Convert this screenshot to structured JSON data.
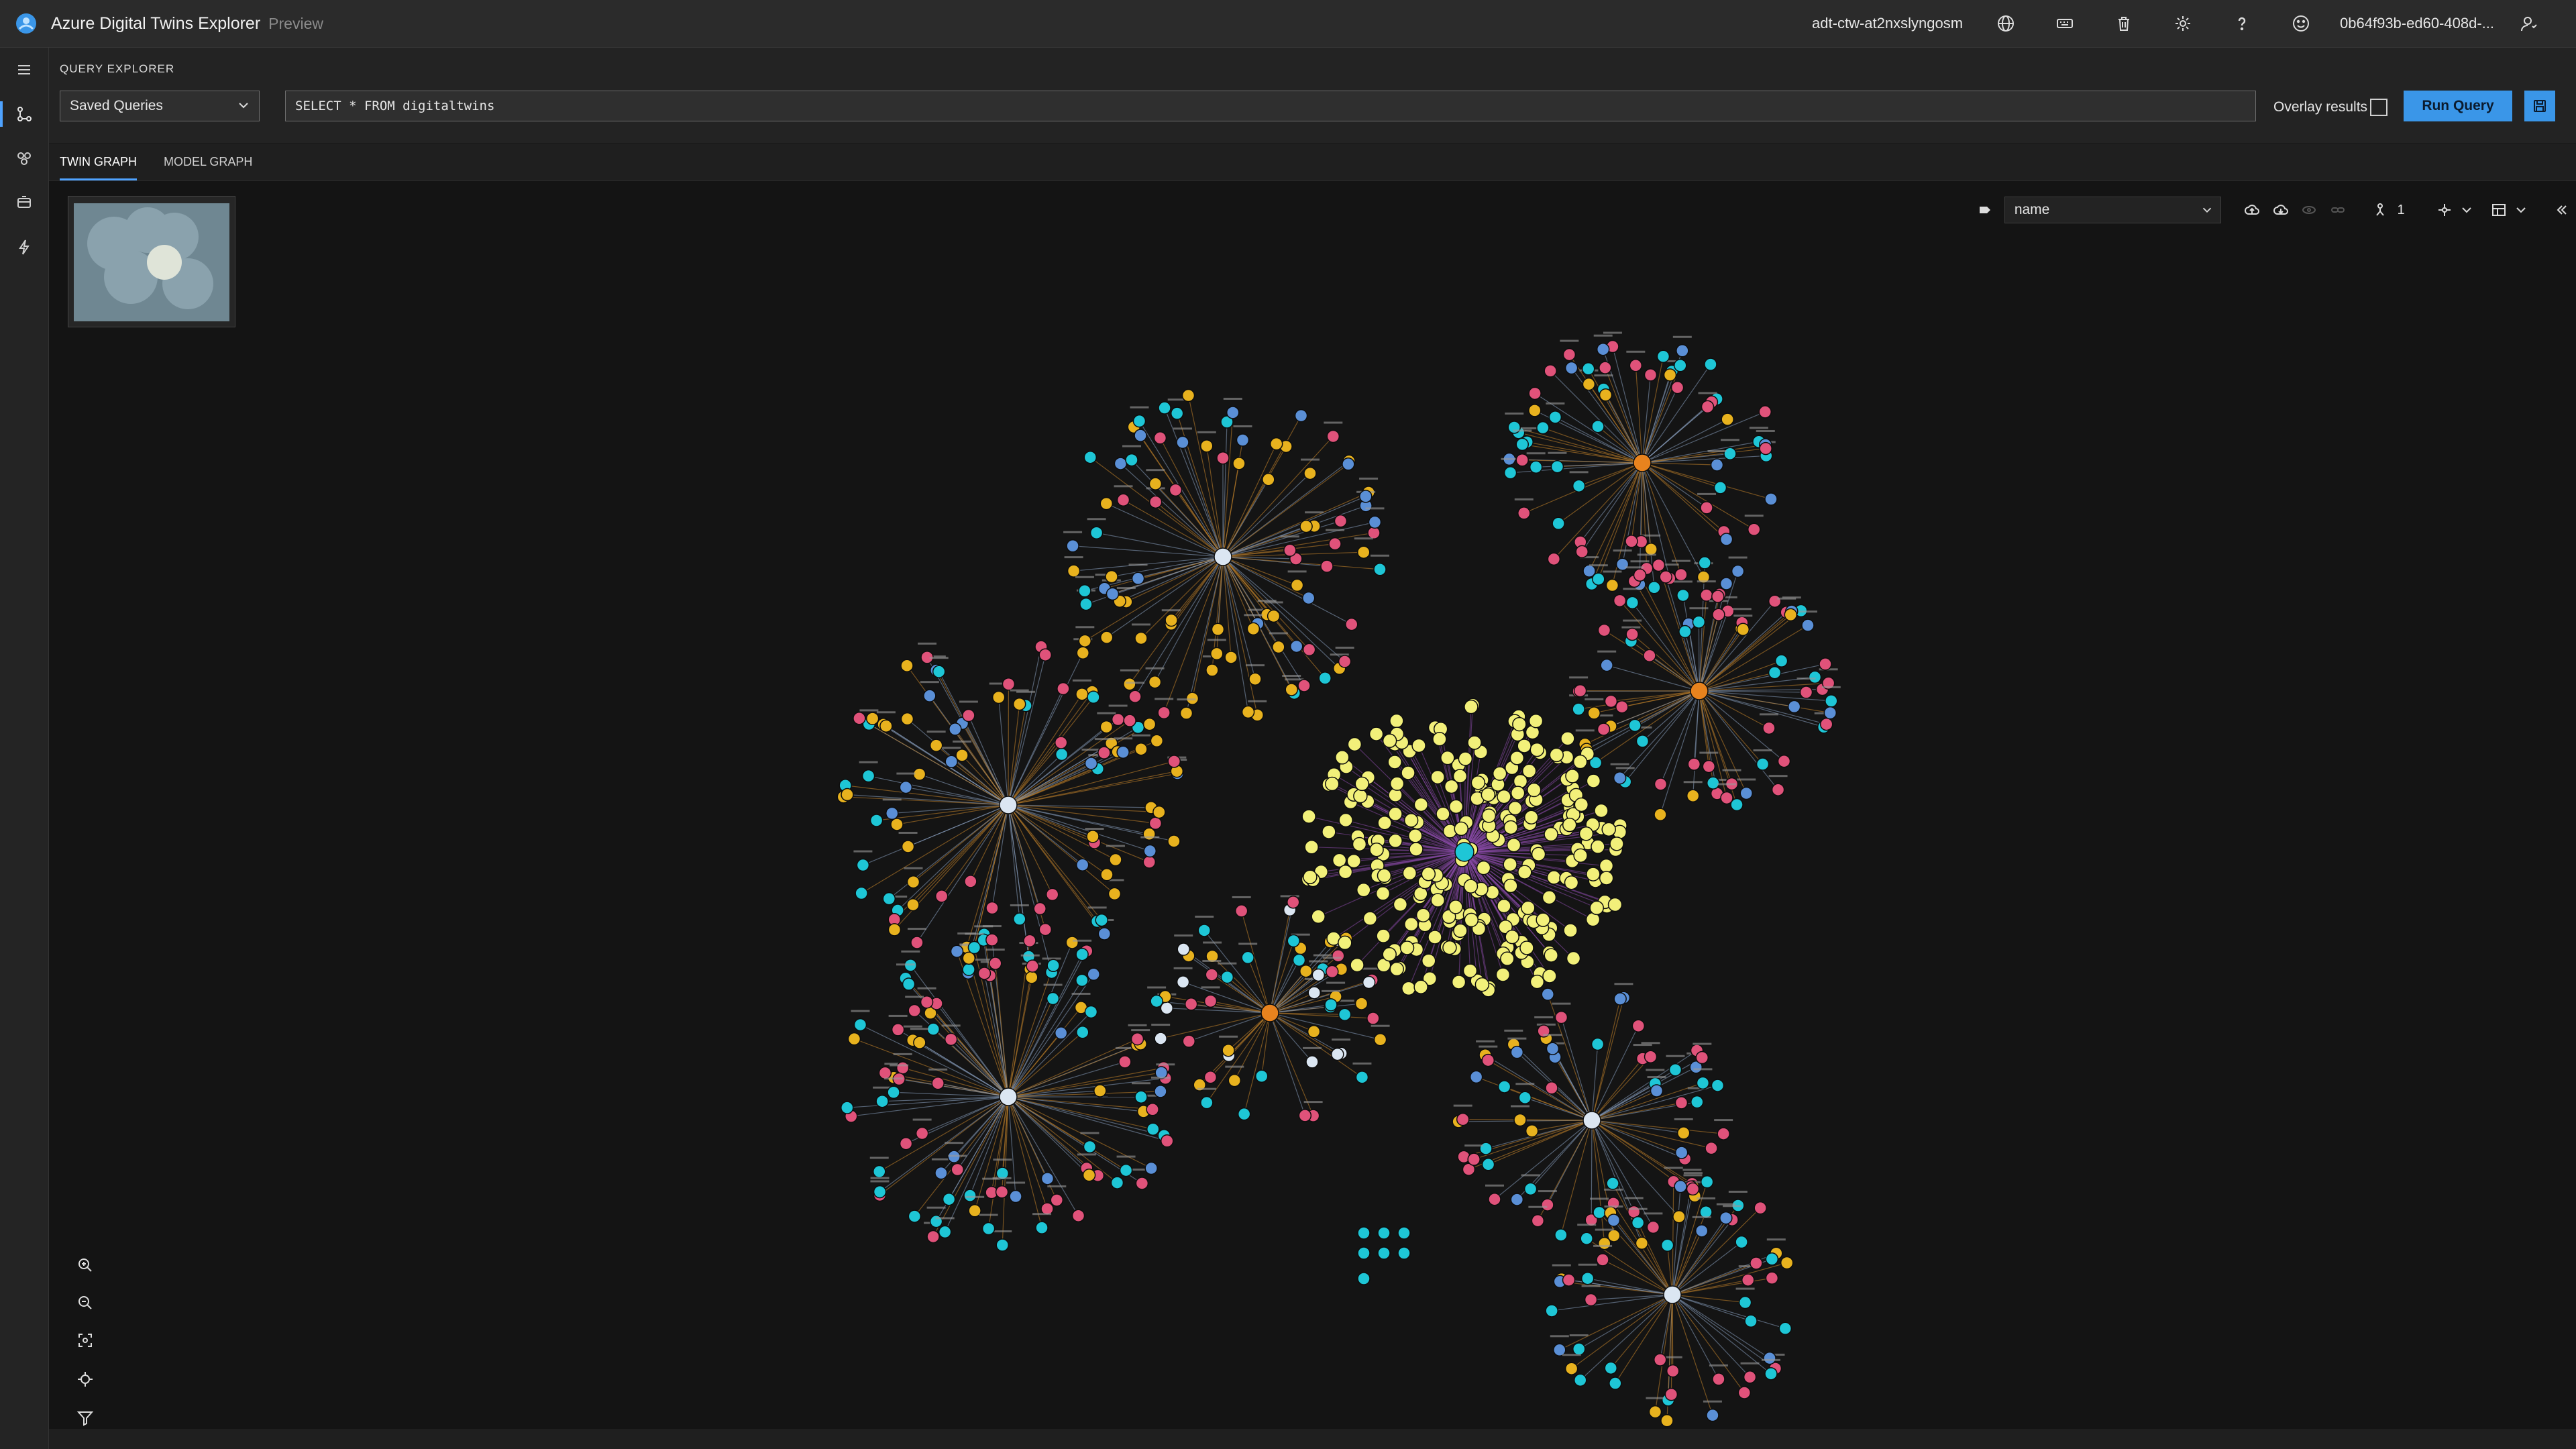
{
  "app": {
    "title": "Azure Digital Twins Explorer",
    "badge": "Preview",
    "environment": "adt-ctw-at2nxslyngosm",
    "user_id": "0b64f93b-ed60-408d-..."
  },
  "topbar_icons": [
    "globe-icon",
    "keyboard-icon",
    "delete-icon",
    "settings-icon",
    "help-icon",
    "feedback-smiley-icon",
    "account-icon"
  ],
  "query": {
    "section_title": "QUERY EXPLORER",
    "saved_queries_label": "Saved Queries",
    "query_text": "SELECT * FROM digitaltwins",
    "overlay_label": "Overlay results",
    "overlay_checked": false,
    "run_label": "Run Query"
  },
  "tabs": [
    {
      "label": "TWIN GRAPH",
      "active": true
    },
    {
      "label": "MODEL GRAPH",
      "active": false
    }
  ],
  "graph": {
    "label_field": "name",
    "hops": "1"
  },
  "colors": {
    "accent": "#3a96e8",
    "node_pink": "#e0527a",
    "node_cyan": "#1ec6d6",
    "node_gold": "#e8b21e",
    "node_blue": "#5a8fd6",
    "node_yellow": "#f2f07a",
    "node_orange": "#e8831e",
    "node_white": "#dbe6f2"
  }
}
